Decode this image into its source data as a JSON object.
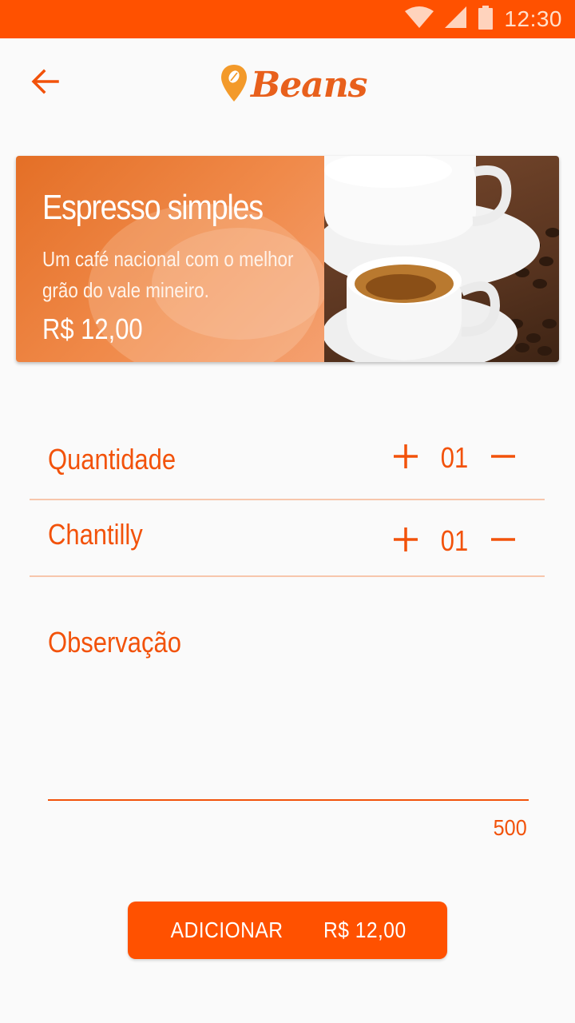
{
  "status_bar": {
    "time": "12:30",
    "icons": [
      "wifi-icon",
      "cell-signal-icon",
      "battery-icon"
    ]
  },
  "header": {
    "back_icon": "arrow-back-icon",
    "logo_text": "Beans"
  },
  "product": {
    "name": "Espresso simples",
    "description": "Um café nacional com o melhor grão do vale mineiro.",
    "price": "R$ 12,00"
  },
  "options": [
    {
      "label": "Quantidade",
      "value": "01"
    },
    {
      "label": "Chantilly",
      "value": "01"
    }
  ],
  "observation": {
    "label": "Observação",
    "value": "",
    "counter": "500"
  },
  "add_button": {
    "label": "ADICIONAR",
    "price": "R$ 12,00"
  },
  "colors": {
    "accent": "#ff5100",
    "text_accent": "#f2520a",
    "background": "#fafafa"
  }
}
